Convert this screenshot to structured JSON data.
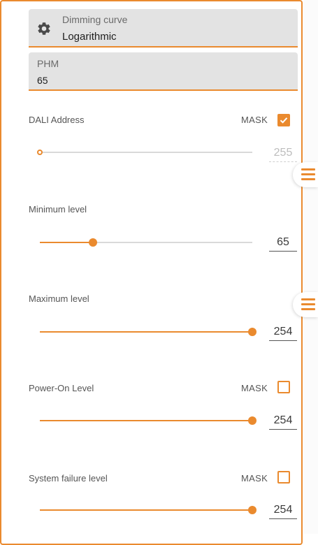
{
  "dimming_curve": {
    "label": "Dimming curve",
    "value": "Logarithmic",
    "icon": "gear-icon"
  },
  "phm": {
    "label": "PHM",
    "value": "65"
  },
  "dali_address": {
    "label": "DALI Address",
    "mask_label": "MASK",
    "mask_checked": true,
    "value": "255",
    "level": 0.0,
    "disabled": true
  },
  "minimum_level": {
    "label": "Minimum level",
    "value": "65",
    "level": 0.25
  },
  "maximum_level": {
    "label": "Maximum level",
    "value": "254",
    "level": 1.0
  },
  "power_on_level": {
    "label": "Power-On Level",
    "mask_label": "MASK",
    "mask_checked": false,
    "value": "254",
    "level": 1.0
  },
  "system_failure_level": {
    "label": "System failure level",
    "mask_label": "MASK",
    "mask_checked": false,
    "value": "254",
    "level": 1.0
  },
  "colors": {
    "accent": "#ea8a2e",
    "track": "#d9d9d9",
    "field_bg": "#e3e3e3"
  }
}
